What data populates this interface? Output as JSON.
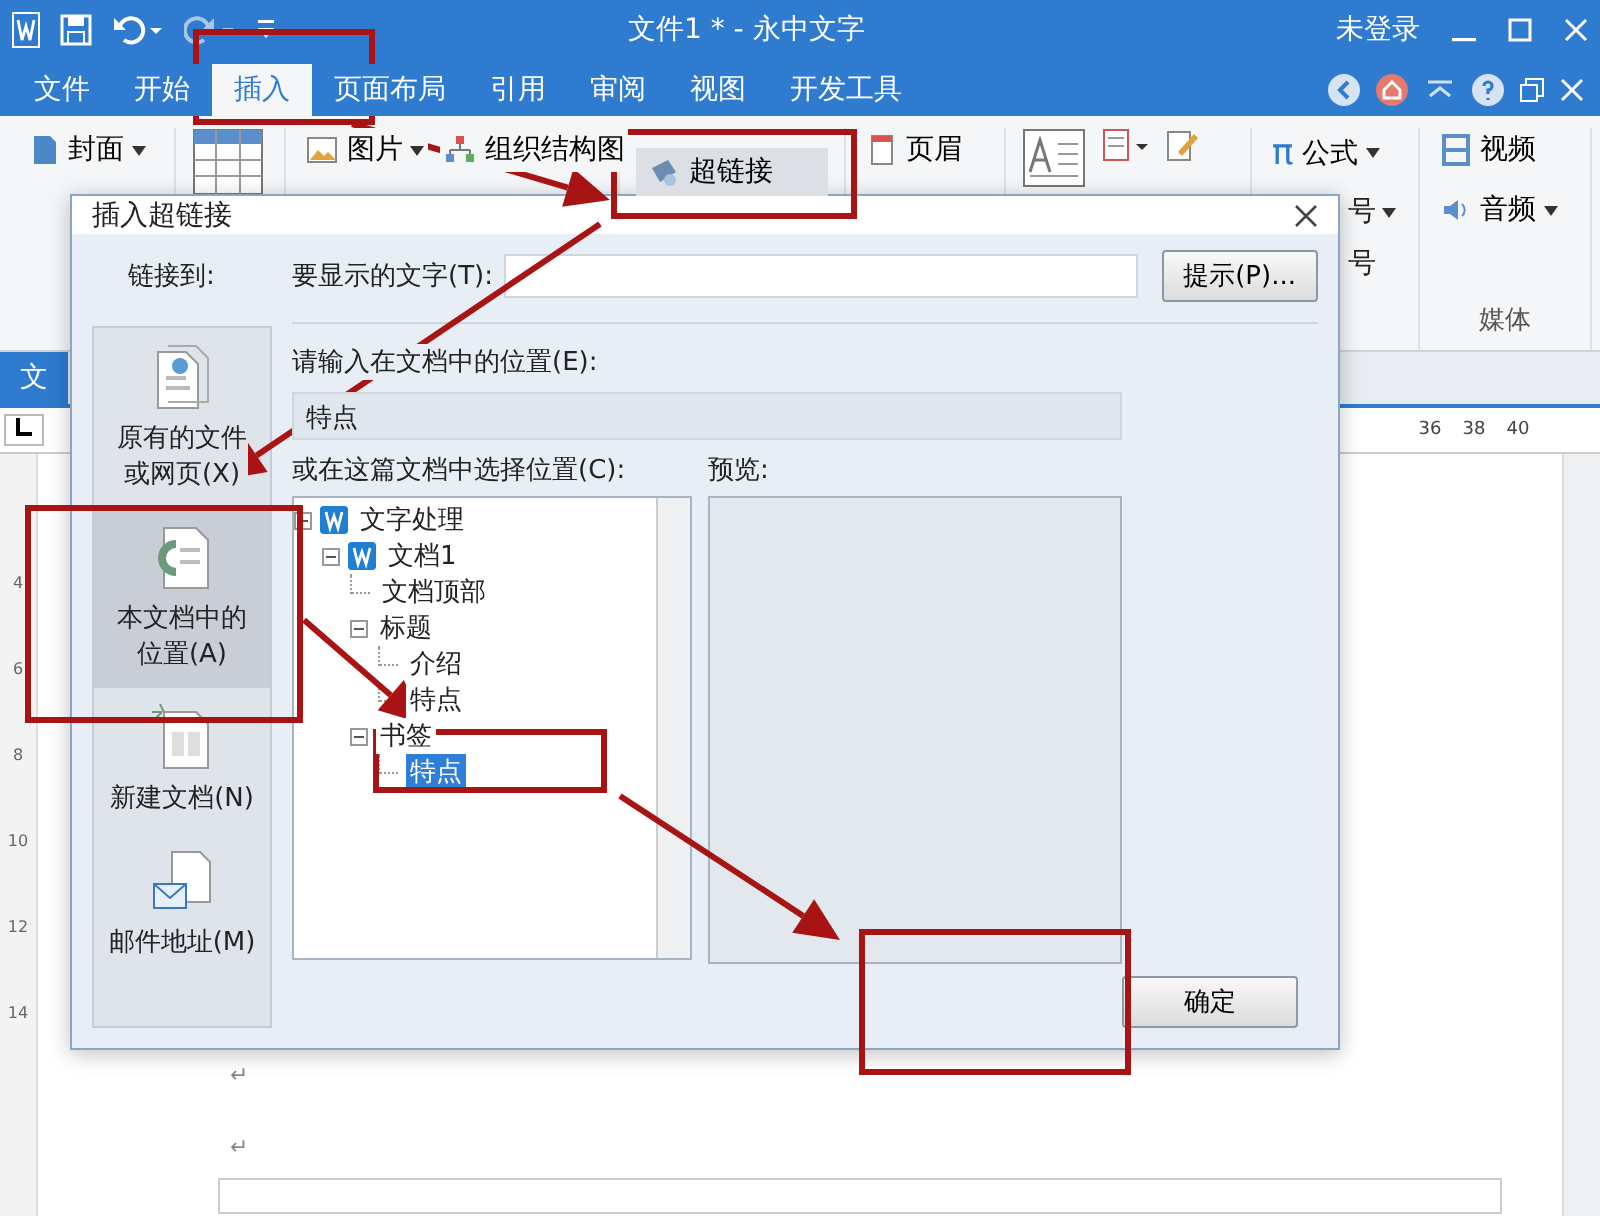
{
  "window": {
    "title": "文件1 * - 永中文字",
    "account": "未登录"
  },
  "menu_tabs": [
    {
      "label": "文件",
      "selected": false
    },
    {
      "label": "开始",
      "selected": false
    },
    {
      "label": "插入",
      "selected": true
    },
    {
      "label": "页面布局",
      "selected": false
    },
    {
      "label": "引用",
      "selected": false
    },
    {
      "label": "审阅",
      "selected": false
    },
    {
      "label": "视图",
      "selected": false
    },
    {
      "label": "开发工具",
      "selected": false
    }
  ],
  "ribbon": {
    "cover": "封面",
    "picture": "图片",
    "org_chart": "组织结构图",
    "hyperlink": "超链接",
    "header": "页眉",
    "formula_symbol": "π",
    "formula": "公式",
    "cut_labels": [
      "号",
      "号"
    ],
    "video": "视频",
    "audio": "音频",
    "media_group": "媒体"
  },
  "doc_tab": "文",
  "ruler_numbers": [
    "36",
    "38",
    "40"
  ],
  "vertical_ruler_numbers": [
    "4",
    "6",
    "8",
    "10",
    "12",
    "14"
  ],
  "paragraph_marks": [
    "↵",
    "↵"
  ],
  "dialog": {
    "title": "插入超链接",
    "link_to_label": "链接到:",
    "link_targets": [
      {
        "lines": [
          "原有的文件",
          "或网页(X)"
        ],
        "kind": "file",
        "selected": false
      },
      {
        "lines": [
          "本文档中的",
          "位置(A)"
        ],
        "kind": "place",
        "selected": true
      },
      {
        "lines": [
          "新建文档(N)"
        ],
        "kind": "new",
        "selected": false
      },
      {
        "lines": [
          "邮件地址(M)"
        ],
        "kind": "mail",
        "selected": false
      }
    ],
    "display_text_label": "要显示的文字(T):",
    "tip_button": "提示(P)...",
    "location_label": "请输入在文档中的位置(E):",
    "location_value": "特点",
    "tree_label": "或在这篇文档中选择位置(C):",
    "tree": [
      {
        "label": "文字处理",
        "kind": "doc",
        "expanded": true,
        "selected": false,
        "children": [
          {
            "label": "文档1",
            "kind": "doc",
            "expanded": true,
            "selected": false,
            "children": [
              {
                "label": "文档顶部",
                "selected": false
              },
              {
                "label": "标题",
                "expanded": true,
                "selected": false,
                "children": [
                  {
                    "label": "介绍",
                    "selected": false
                  },
                  {
                    "label": "特点",
                    "selected": false
                  }
                ]
              },
              {
                "label": "书签",
                "expanded": true,
                "selected": false,
                "children": [
                  {
                    "label": "特点",
                    "selected": true
                  }
                ]
              }
            ]
          }
        ]
      }
    ],
    "preview_label": "预览:",
    "ok_button": "确定"
  }
}
